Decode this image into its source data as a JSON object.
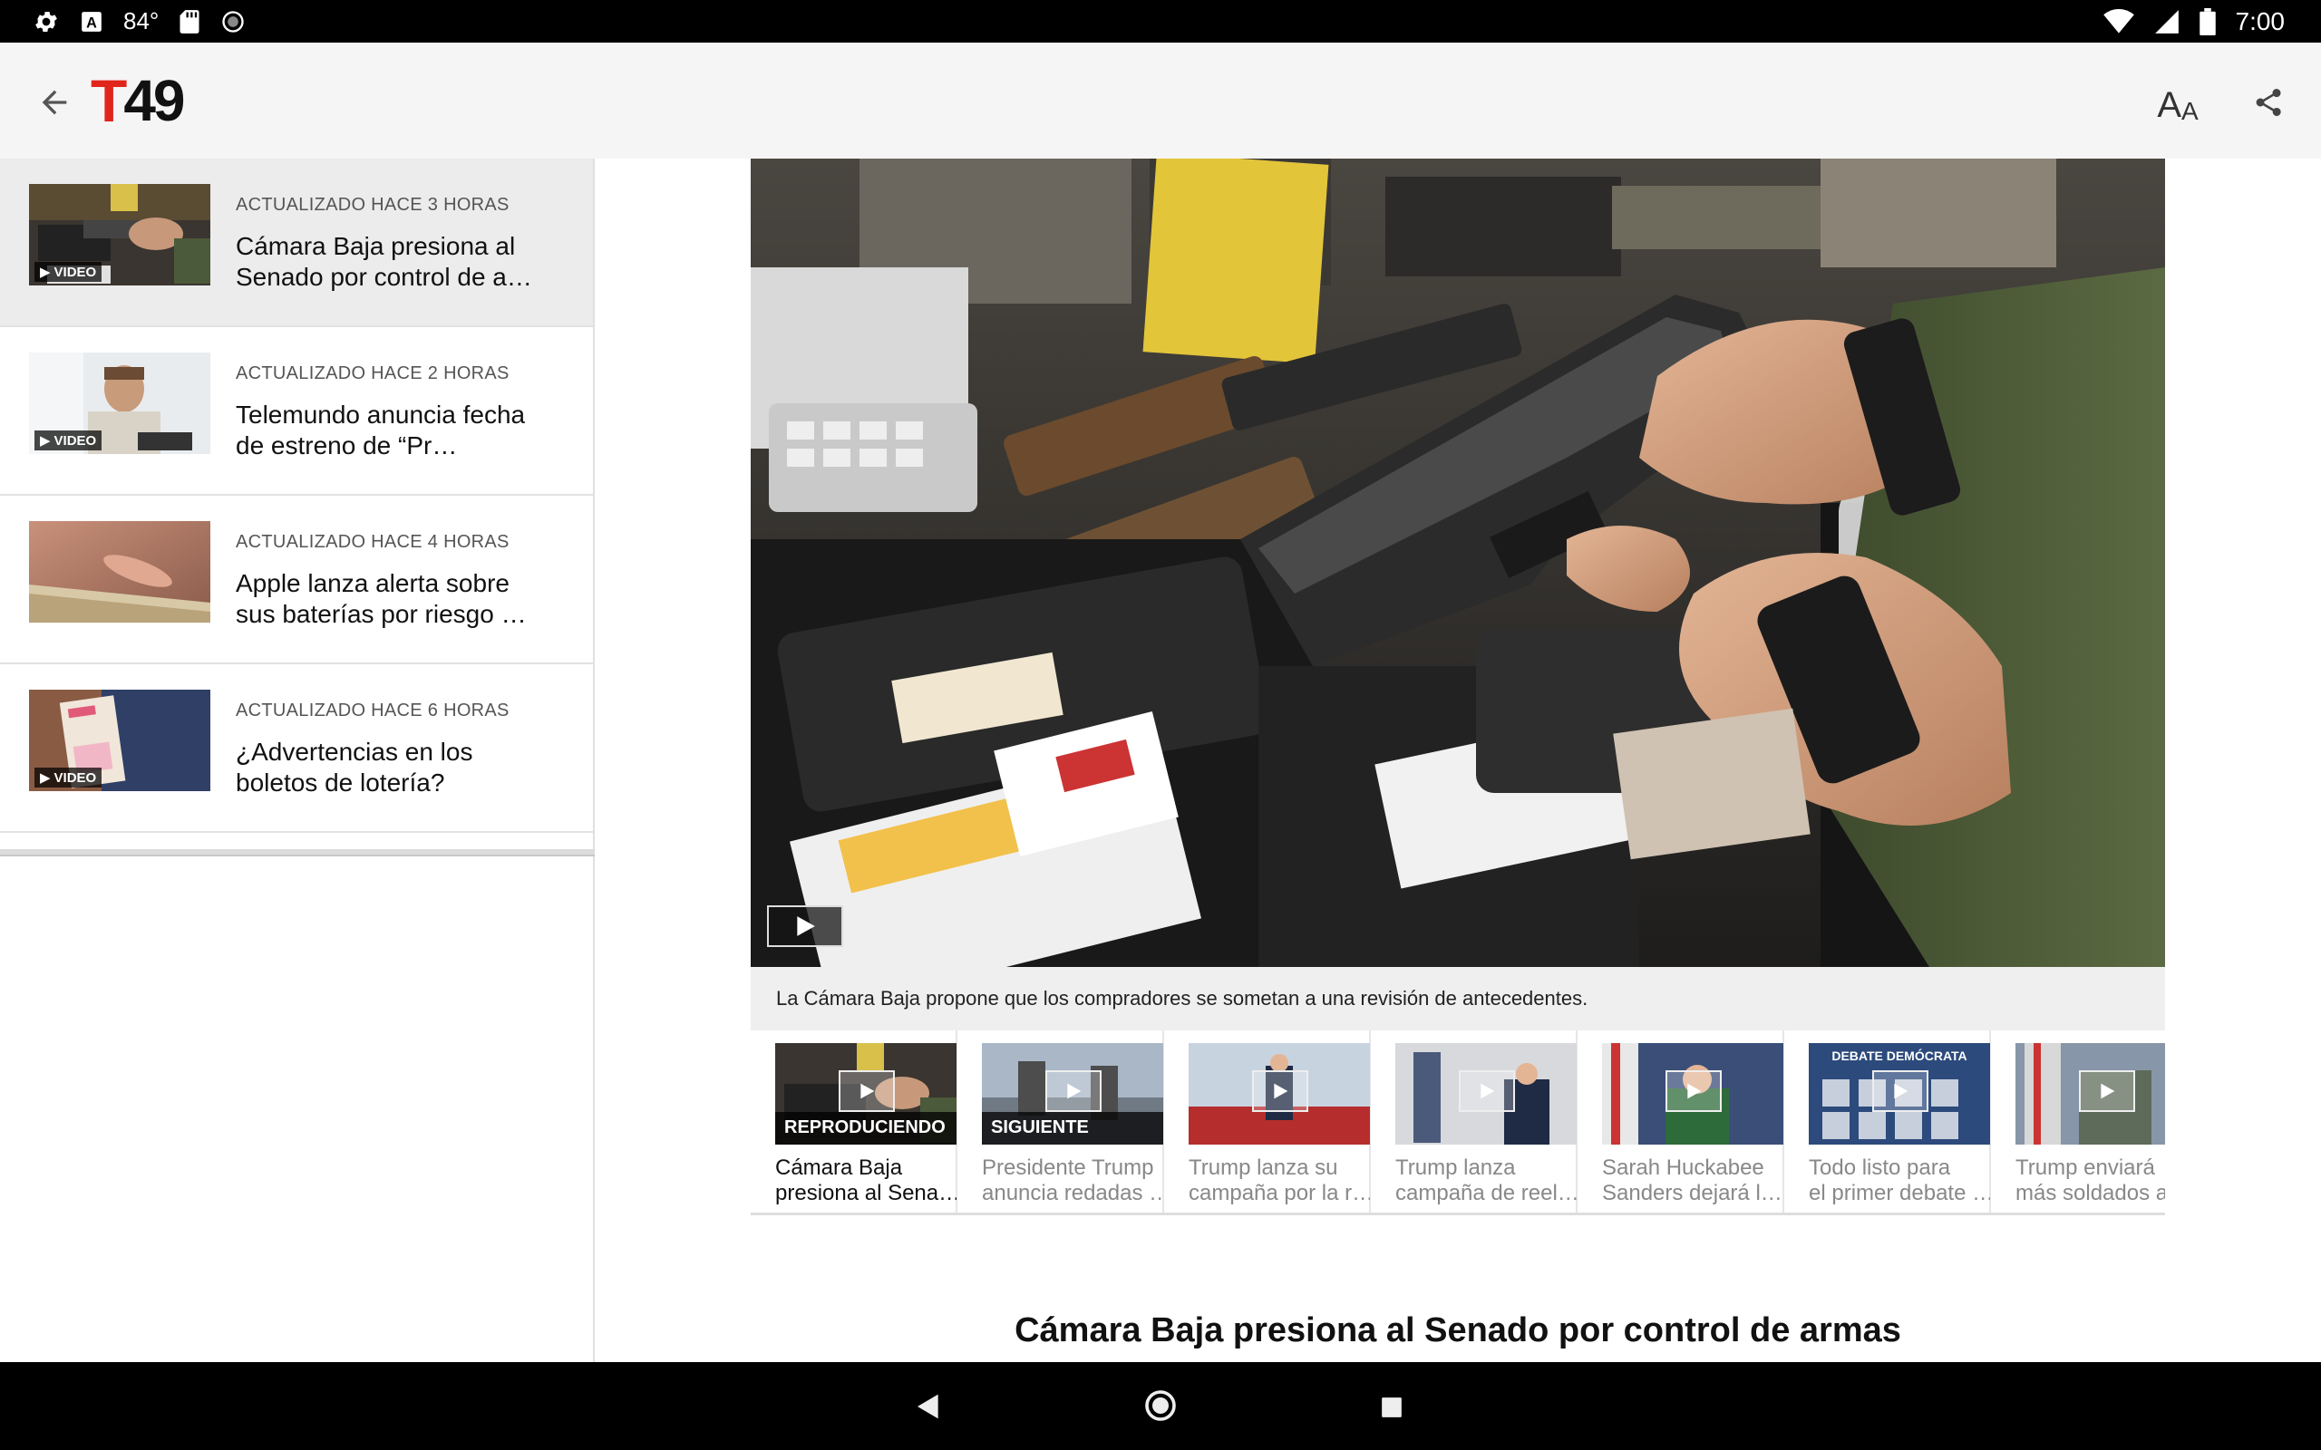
{
  "status_bar": {
    "temperature": "84°",
    "time": "7:00",
    "icons_left": [
      "settings-icon",
      "accessibility-icon",
      "sd-card-icon",
      "circle-icon"
    ],
    "icons_right": [
      "wifi-icon",
      "signal-icon",
      "battery-icon"
    ]
  },
  "app_bar": {
    "logo_letter": "T",
    "logo_number": "49",
    "font_size_label_big": "A",
    "font_size_label_small": "A",
    "brand_color": "#e1251b"
  },
  "sidebar": {
    "stories": [
      {
        "meta": "ACTUALIZADO HACE 3 HORAS",
        "title": "Cámara Baja presiona al Senado por control de a…",
        "badge": "VIDEO",
        "has_video": true,
        "selected": true
      },
      {
        "meta": "ACTUALIZADO HACE 2 HORAS",
        "title": "Telemundo anuncia fecha de estreno de “Pr…",
        "badge": "VIDEO",
        "has_video": true,
        "selected": false
      },
      {
        "meta": "ACTUALIZADO HACE 4 HORAS",
        "title": "Apple lanza alerta sobre sus baterías por riesgo …",
        "badge": "",
        "has_video": false,
        "selected": false
      },
      {
        "meta": "ACTUALIZADO HACE 6 HORAS",
        "title": "¿Advertencias en los boletos de lotería?",
        "badge": "VIDEO",
        "has_video": true,
        "selected": false
      }
    ]
  },
  "main": {
    "caption": "La Cámara Baja propone que los compradores se sometan a una revisión de antecedentes.",
    "playlist": [
      {
        "status": "REPRODUCIENDO",
        "title_line1": "Cámara Baja",
        "title_line2": "presiona al Sena…",
        "active": true
      },
      {
        "status": "SIGUIENTE",
        "title_line1": "Presidente Trump",
        "title_line2": "anuncia redadas …",
        "active": false
      },
      {
        "status": "",
        "title_line1": "Trump lanza su",
        "title_line2": "campaña por la r…",
        "active": false
      },
      {
        "status": "",
        "title_line1": "Trump lanza",
        "title_line2": "campaña de reel…",
        "active": false
      },
      {
        "status": "",
        "title_line1": "Sarah Huckabee",
        "title_line2": "Sanders dejará l…",
        "active": false
      },
      {
        "status": "",
        "title_line1": "Todo listo para",
        "title_line2": "el primer debate …",
        "active": false,
        "thumb_text": "DEBATE DEMÓCRATA"
      },
      {
        "status": "",
        "title_line1": "Trump enviará",
        "title_line2": "más soldados a",
        "active": false
      }
    ],
    "article_title": "Cámara Baja presiona al Senado por control de armas"
  },
  "nav_bar": {
    "buttons": [
      "back-triangle-icon",
      "home-circle-icon",
      "recents-square-icon"
    ]
  }
}
